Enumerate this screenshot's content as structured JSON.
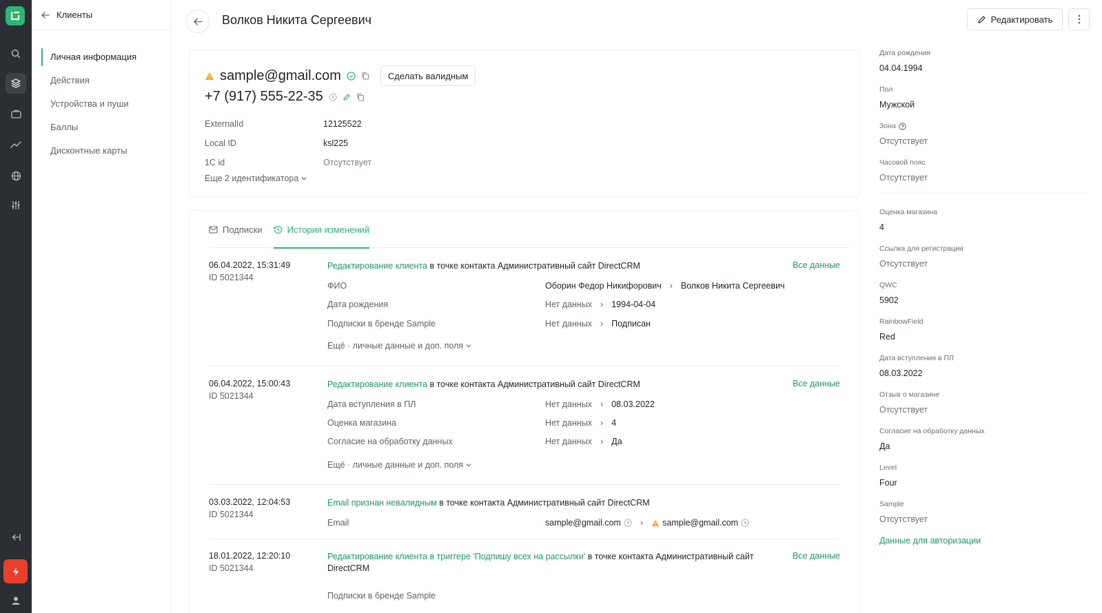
{
  "sidebar": {
    "back_label": "Клиенты",
    "items": [
      {
        "label": "Личная информация",
        "active": true
      },
      {
        "label": "Действия"
      },
      {
        "label": "Устройства и пуши"
      },
      {
        "label": "Баллы"
      },
      {
        "label": "Дисконтные карты"
      }
    ]
  },
  "rail": {
    "icons": [
      "search-icon",
      "layers-icon",
      "briefcase-icon",
      "chart-icon",
      "globe-icon",
      "sliders-icon",
      "collapse-icon",
      "bolt-icon",
      "user-icon"
    ]
  },
  "header": {
    "title": "Волков Никита Сергеевич",
    "edit_label": "Редактировать"
  },
  "contact": {
    "email": "sample@gmail.com",
    "make_valid_label": "Сделать валидным",
    "phone": "+7 (917) 555-22-35",
    "ids": [
      {
        "key": "ExternalId",
        "value": "12125522"
      },
      {
        "key": "Local ID",
        "value": "ksl225"
      },
      {
        "key": "1C id",
        "value": "Отсутствует"
      }
    ],
    "more_ids": "Еще 2 идентификатора"
  },
  "tabs": [
    {
      "label": "Подписки"
    },
    {
      "label": "История изменений",
      "active": true
    }
  ],
  "history": [
    {
      "date": "06.04.2022, 15:31:49",
      "id": "ID 5021344",
      "link": "Редактирование клиента",
      "rest": " в точке контакта Административный сайт DirectCRM",
      "all": "Все данные",
      "fields": [
        {
          "key": "ФИО",
          "old": "Оборин Федор Никифорович",
          "new": "Волков Никита Сергеевич"
        },
        {
          "key": "Дата рождения",
          "old": "Нет данных",
          "new": "1994-04-04"
        },
        {
          "key": "Подписки в бренде Sample",
          "old": "Нет данных",
          "new": "Подписан"
        }
      ],
      "more": "Ещё · личные данные и доп. поля"
    },
    {
      "date": "06.04.2022, 15:00:43",
      "id": "ID 5021344",
      "link": "Редактирование клиента",
      "rest": " в точке контакта Административный сайт DirectCRM",
      "all": "Все данные",
      "fields": [
        {
          "key": "Дата вступления в ПЛ",
          "old": "Нет данных",
          "new": "08.03.2022"
        },
        {
          "key": "Оценка магазина",
          "old": "Нет данных",
          "new": "4"
        },
        {
          "key": "Согласие на обработку данных",
          "old": "Нет данных",
          "new": "Да"
        }
      ],
      "more": "Ещё · личные данные и доп. поля"
    },
    {
      "date": "03.03.2022, 12:04:53",
      "id": "ID 5021344",
      "link": "Email признан невалидным",
      "rest": " в точке контакта Административный сайт DirectCRM",
      "fields": [
        {
          "key": "Email",
          "old": "sample@gmail.com",
          "new": "sample@gmail.com"
        }
      ]
    },
    {
      "date": "18.01.2022, 12:20:10",
      "id": "ID 5021344",
      "link": "Редактирование клиента в триггере 'Подпишу всех на рассылки'",
      "rest": " в точке контакта Административный сайт DirectCRM",
      "all": "Все данные",
      "fields": [
        {
          "key": "Подписки в бренде Sample"
        }
      ]
    }
  ],
  "profile": {
    "fields_top": [
      {
        "label": "Дата рождения",
        "value": "04.04.1994"
      },
      {
        "label": "Пол",
        "value": "Мужской"
      },
      {
        "label": "Зона",
        "value": "Отсутствует",
        "muted": true,
        "help": true
      },
      {
        "label": "Часовой пояс",
        "value": "Отсутствует",
        "muted": true
      }
    ],
    "fields_bottom": [
      {
        "label": "Оценка магазина",
        "value": "4"
      },
      {
        "label": "Ссылка для регистрации",
        "value": "Отсутствует",
        "muted": true
      },
      {
        "label": "QWC",
        "value": "5902"
      },
      {
        "label": "RainbowField",
        "value": "Red"
      },
      {
        "label": "Дата вступления в ПЛ",
        "value": "08.03.2022"
      },
      {
        "label": "Отзыв о магазине",
        "value": "Отсутствует",
        "muted": true
      },
      {
        "label": "Согласие на обработку данных",
        "value": "Да"
      },
      {
        "label": "Level",
        "value": "Four"
      },
      {
        "label": "Sample",
        "value": "Отсутствует",
        "muted": true
      }
    ],
    "auth_link": "Данные для авторизации"
  },
  "colors": {
    "accent": "#2bb673",
    "rail": "#2b2f33",
    "warning": "#f5a623",
    "danger": "#e8402d"
  }
}
